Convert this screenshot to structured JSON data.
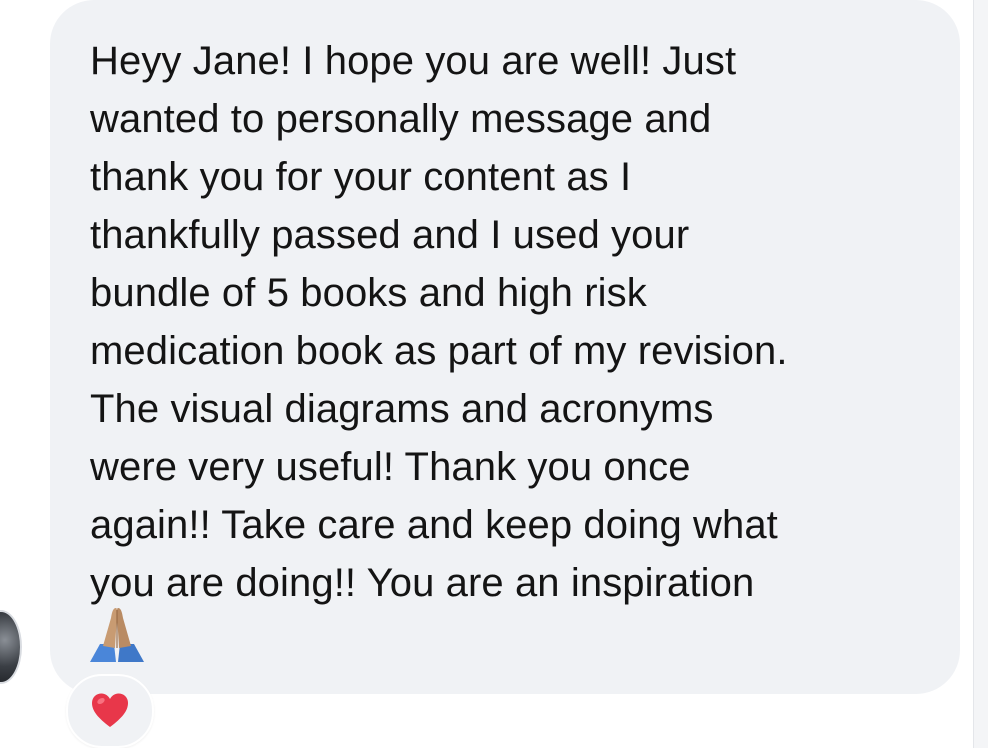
{
  "message": {
    "text": "Heyy Jane! I hope you are well! Just\nwanted to personally message and\nthank you for your content as I\nthankfully passed and I used your\nbundle of 5 books and high risk\nmedication book as part of my revision.\nThe visual diagrams and acronyms\nwere very useful! Thank you once\nagain!! Take care and keep doing what\nyou are doing!! You are an inspiration",
    "trailing_emoji": "folded-hands-icon",
    "bubble_color": "#f0f2f5",
    "text_color": "#141414"
  },
  "reaction": {
    "icon": "heart-icon",
    "color": "#e8374a"
  }
}
